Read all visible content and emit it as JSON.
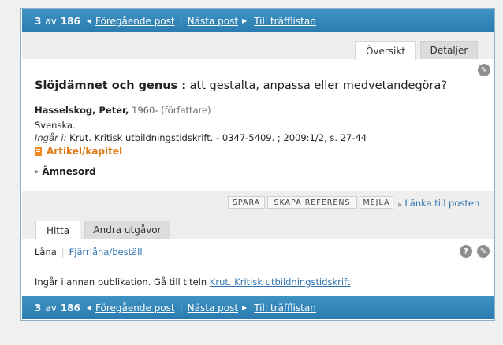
{
  "nav": {
    "current": "3",
    "of": "av",
    "total": "186",
    "prev": "Föregående post",
    "next": "Nästa post",
    "list": "Till träfflistan"
  },
  "tabs": [
    "Översikt",
    "Detaljer"
  ],
  "record": {
    "title_main": "Slöjdämnet och genus :",
    "title_sub": " att gestalta, anpassa eller medvetandegöra?",
    "author_name": "Hasselskog, Peter,",
    "author_extra": " 1960- (författare)",
    "language": "Svenska.",
    "ingar_label": "Ingår i:",
    "ingar_text": " Krut. Kritisk utbildningstidskrift. - 0347-5409. ; 2009:1/2, s. 27-44",
    "type": "Artikel/kapitel",
    "amnesord": "Ämnesord"
  },
  "actions": {
    "spara": "SPARA",
    "skapa": "SKAPA REFERENS",
    "mejla": "MEJLA",
    "lanka": "Länka till posten"
  },
  "lower_tabs": [
    "Hitta",
    "Andra utgåvor"
  ],
  "hitta": {
    "lana": "Låna",
    "fjarr": "Fjärrlåna/beställ",
    "pub_text": "Ingår i annan publikation. Gå till titeln ",
    "pub_link": "Krut. Kritisk utbildningstidskrift"
  },
  "icons": {
    "wrench": "wrench-icon",
    "help": "help-icon"
  },
  "colors": {
    "nav_bar": "#2f84b8",
    "link": "#2d73b0",
    "type_accent": "#e07b1a"
  }
}
